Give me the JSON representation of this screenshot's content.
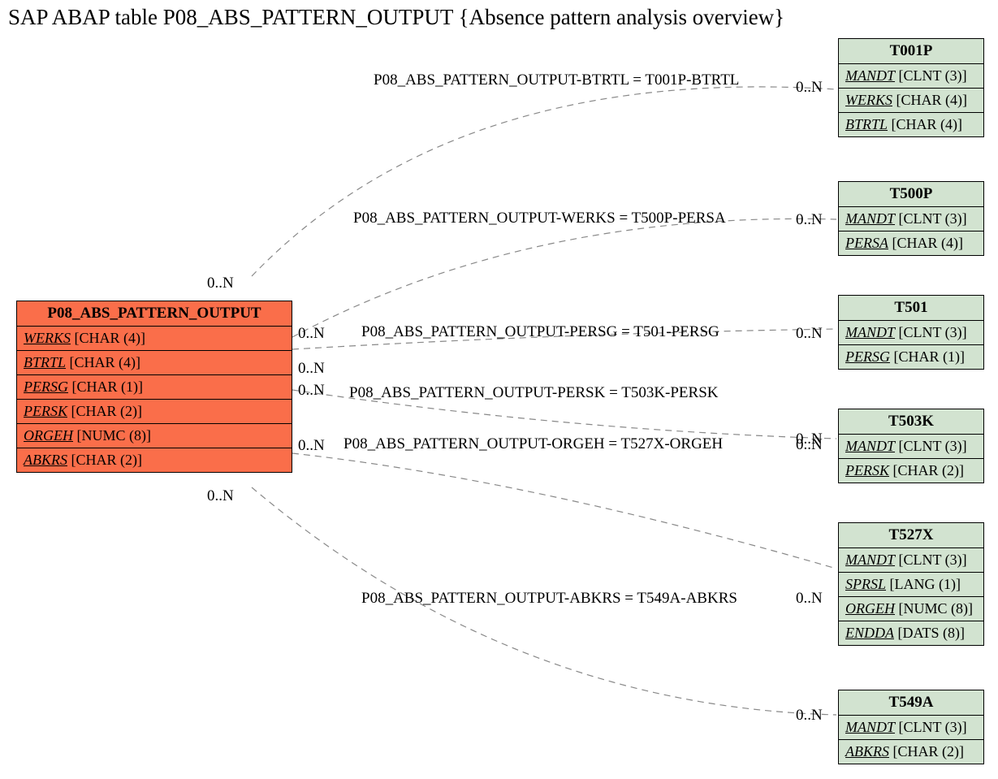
{
  "title": "SAP ABAP table P08_ABS_PATTERN_OUTPUT {Absence pattern analysis overview}",
  "main": {
    "name": "P08_ABS_PATTERN_OUTPUT",
    "fields": [
      {
        "n": "WERKS",
        "t": "[CHAR (4)]"
      },
      {
        "n": "BTRTL",
        "t": "[CHAR (4)]"
      },
      {
        "n": "PERSG",
        "t": "[CHAR (1)]"
      },
      {
        "n": "PERSK",
        "t": "[CHAR (2)]"
      },
      {
        "n": "ORGEH",
        "t": "[NUMC (8)]"
      },
      {
        "n": "ABKRS",
        "t": "[CHAR (2)]"
      }
    ]
  },
  "rel": [
    {
      "label": "P08_ABS_PATTERN_OUTPUT-BTRTL = T001P-BTRTL",
      "c1": "0..N",
      "c2": "0..N"
    },
    {
      "label": "P08_ABS_PATTERN_OUTPUT-WERKS = T500P-PERSA",
      "c1": "0..N",
      "c2": "0..N"
    },
    {
      "label": "P08_ABS_PATTERN_OUTPUT-PERSG = T501-PERSG",
      "c1": "0..N",
      "c2": "0..N"
    },
    {
      "label": "P08_ABS_PATTERN_OUTPUT-PERSK = T503K-PERSK",
      "c1": "0..N",
      "c2": "0..N"
    },
    {
      "label": "P08_ABS_PATTERN_OUTPUT-ORGEH = T527X-ORGEH",
      "c1": "0..N",
      "c2": "0..N"
    },
    {
      "label": "P08_ABS_PATTERN_OUTPUT-ABKRS = T549A-ABKRS",
      "c1": "0..N",
      "c2": "0..N"
    }
  ],
  "targets": [
    {
      "name": "T001P",
      "fields": [
        {
          "n": "MANDT",
          "t": "[CLNT (3)]"
        },
        {
          "n": "WERKS",
          "t": "[CHAR (4)]"
        },
        {
          "n": "BTRTL",
          "t": "[CHAR (4)]"
        }
      ]
    },
    {
      "name": "T500P",
      "fields": [
        {
          "n": "MANDT",
          "t": "[CLNT (3)]"
        },
        {
          "n": "PERSA",
          "t": "[CHAR (4)]"
        }
      ]
    },
    {
      "name": "T501",
      "fields": [
        {
          "n": "MANDT",
          "t": "[CLNT (3)]"
        },
        {
          "n": "PERSG",
          "t": "[CHAR (1)]"
        }
      ]
    },
    {
      "name": "T503K",
      "fields": [
        {
          "n": "MANDT",
          "t": "[CLNT (3)]"
        },
        {
          "n": "PERSK",
          "t": "[CHAR (2)]"
        }
      ]
    },
    {
      "name": "T527X",
      "fields": [
        {
          "n": "MANDT",
          "t": "[CLNT (3)]"
        },
        {
          "n": "SPRSL",
          "t": "[LANG (1)]"
        },
        {
          "n": "ORGEH",
          "t": "[NUMC (8)]"
        },
        {
          "n": "ENDDA",
          "t": "[DATS (8)]"
        }
      ]
    },
    {
      "name": "T549A",
      "fields": [
        {
          "n": "MANDT",
          "t": "[CLNT (3)]"
        },
        {
          "n": "ABKRS",
          "t": "[CHAR (2)]"
        }
      ]
    }
  ]
}
